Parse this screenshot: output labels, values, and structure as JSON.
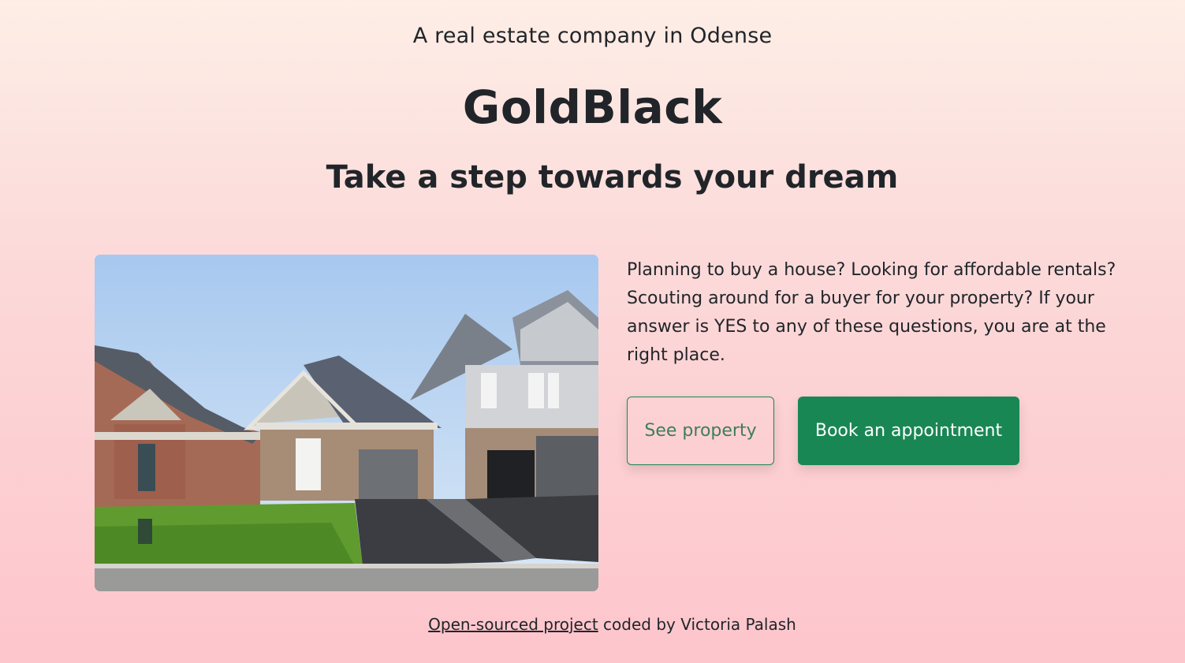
{
  "header": {
    "tagline": "A real estate company in Odense",
    "brand": "GoldBlack",
    "slogan": "Take a step towards your dream"
  },
  "hero": {
    "image_subject": "suburban houses with driveways and lawn",
    "intro_text": "Planning to buy a house? Looking for affordable rentals? Scouting around for a buyer for your property? If your answer is YES to any of these questions, you are at the right place."
  },
  "actions": {
    "see_property_label": "See property",
    "book_label": "Book an appointment"
  },
  "footer": {
    "link_text": "Open-sourced project",
    "credit_text": " coded by Victoria Palash"
  },
  "colors": {
    "accent": "#198754",
    "text": "#212529",
    "background_top": "#fdeee6",
    "background_bottom": "#fdc5cc"
  }
}
